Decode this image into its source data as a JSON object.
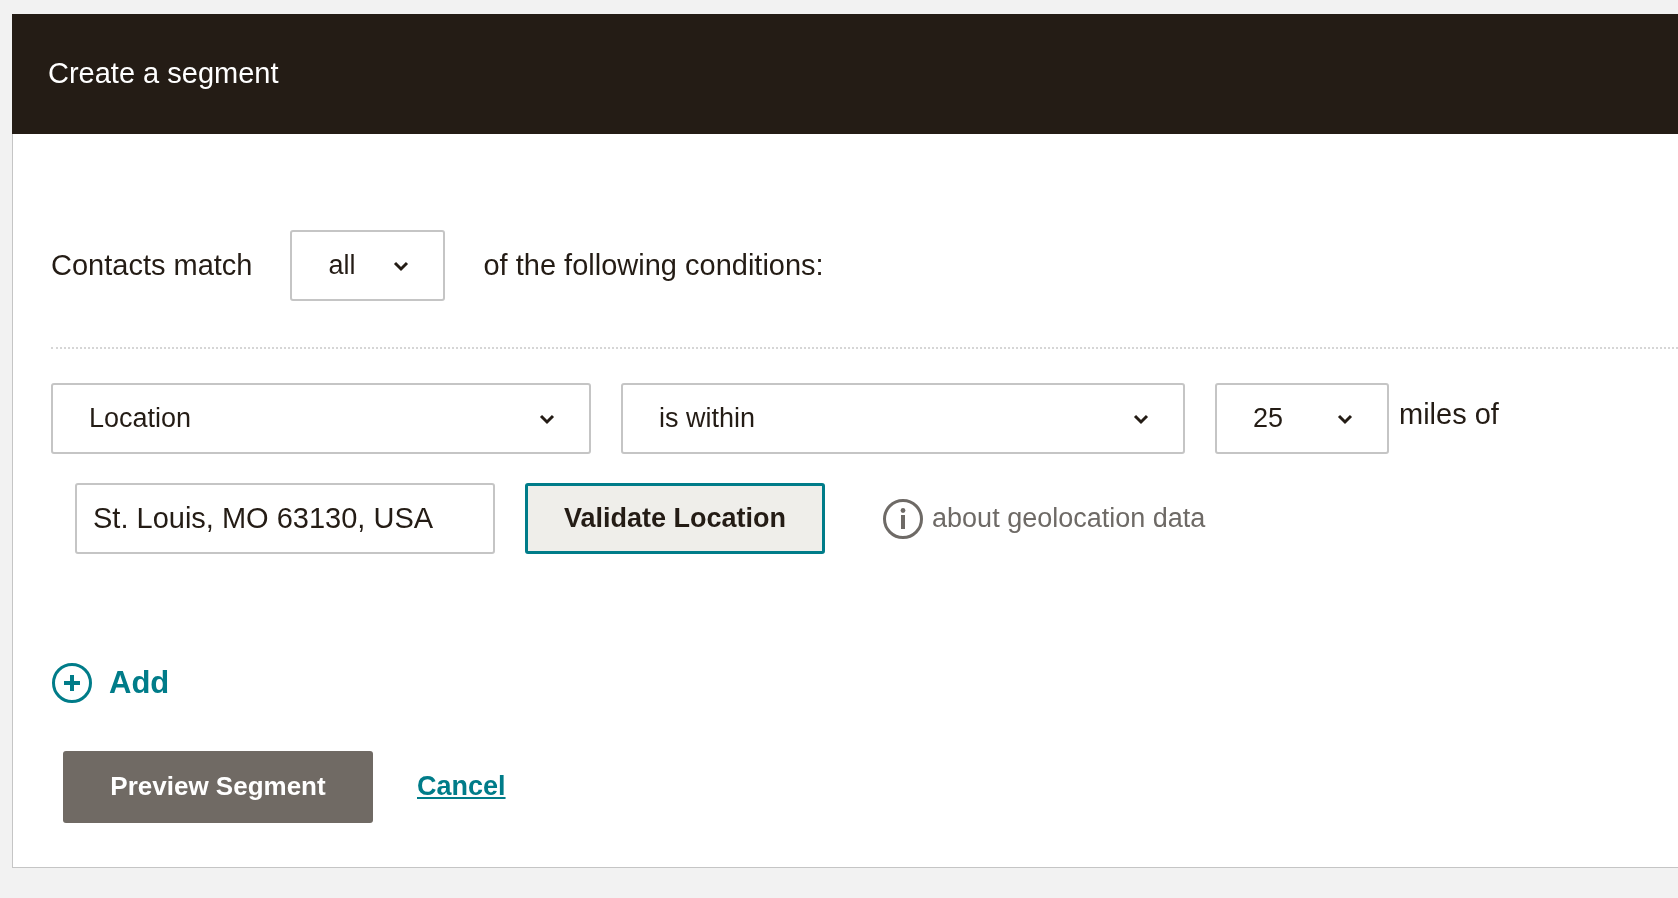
{
  "header": {
    "title": "Create a segment"
  },
  "match": {
    "label": "Contacts match",
    "select": {
      "value": "all"
    },
    "suffix": "of the following conditions:"
  },
  "condition": {
    "field": {
      "value": "Location"
    },
    "operator": {
      "value": "is within"
    },
    "distance": {
      "value": "25"
    },
    "unit_label": "miles of",
    "location_input": {
      "value": "St. Louis, MO 63130, USA"
    },
    "validate_button": {
      "label": "Validate Location",
      "focused": true
    },
    "info_link": {
      "label": "about geolocation data"
    }
  },
  "add": {
    "label": "Add"
  },
  "actions": {
    "preview": {
      "label": "Preview Segment"
    },
    "cancel": {
      "label": "Cancel"
    }
  }
}
